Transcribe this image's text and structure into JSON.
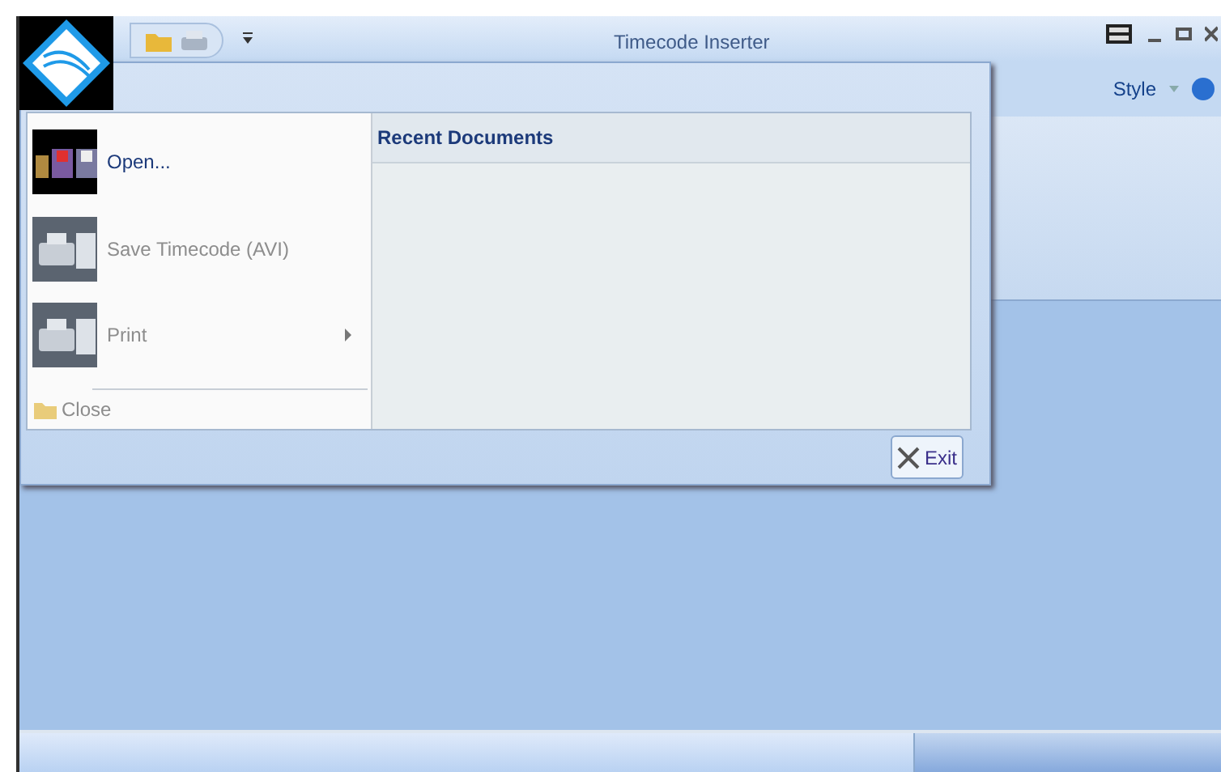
{
  "window": {
    "title": "Timecode Inserter"
  },
  "ribbon": {
    "style_menu": "Style"
  },
  "app_menu": {
    "items": [
      {
        "kind": "large",
        "label": "Open...",
        "disabled": false,
        "has_submenu": false
      },
      {
        "kind": "large",
        "label": "Save Timecode (AVI)",
        "disabled": true,
        "has_submenu": false
      },
      {
        "kind": "large",
        "label": "Print",
        "disabled": true,
        "has_submenu": true
      },
      {
        "kind": "small",
        "label": "Close",
        "disabled": true,
        "has_submenu": false
      }
    ],
    "recent_documents": {
      "title": "Recent Documents"
    },
    "exit_button": "Exit"
  }
}
